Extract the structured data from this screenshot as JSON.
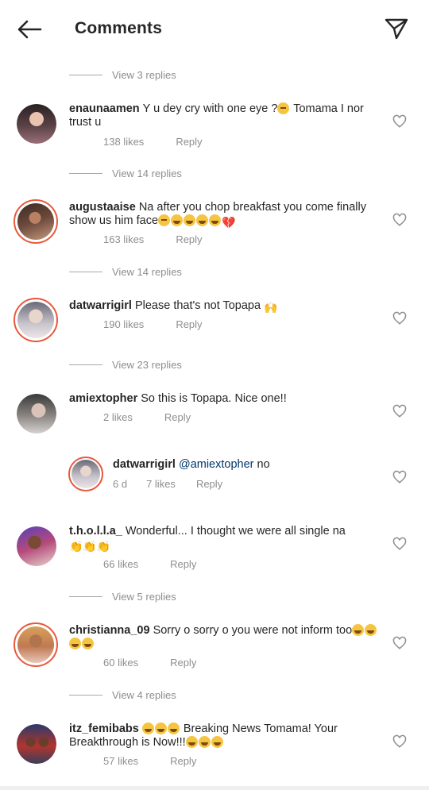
{
  "header": {
    "title": "Comments"
  },
  "view_replies": [
    "View 3 replies",
    "View 14 replies",
    "View 14 replies",
    "View 23 replies",
    "View 5 replies",
    "View 4 replies"
  ],
  "comments": [
    {
      "user": "enaunaamen",
      "text": "Y u dey cry with one eye ?",
      "text2": " Tomama I nor trust u",
      "likes": "138 likes",
      "reply": "Reply"
    },
    {
      "user": "augustaaise",
      "text": "Na after you chop breakfast you come finally show us him face",
      "likes": "163 likes",
      "reply": "Reply"
    },
    {
      "user": "datwarrigirl",
      "text": "Please that's not Topapa ",
      "likes": "190 likes",
      "reply": "Reply"
    },
    {
      "user": "amiextopher",
      "text": "So this is Topapa. Nice one!!",
      "likes": "2 likes",
      "reply": "Reply"
    },
    {
      "user": "datwarrigirl",
      "mention": "@amiextopher",
      "text": " no",
      "time": "6 d",
      "likes": "7 likes",
      "reply": "Reply"
    },
    {
      "user": "t.h.o.l.l.a_",
      "text": "Wonderful... I thought we were all single na ",
      "likes": "66 likes",
      "reply": "Reply"
    },
    {
      "user": "christianna_09",
      "text": "Sorry o sorry o you were not inform too",
      "likes": "60 likes",
      "reply": "Reply"
    },
    {
      "user": "itz_femibabs",
      "text": " Breaking News Tomama! Your Breakthrough is Now!!!",
      "likes": "57 likes",
      "reply": "Reply"
    }
  ],
  "colors": {
    "story_ring": "#e8593c",
    "secondary_text": "#8e8e8e",
    "primary_text": "#262626",
    "mention": "#00376b"
  },
  "icons": {
    "back": "arrow-left-icon",
    "send": "paper-plane-icon",
    "like": "heart-outline-icon"
  }
}
